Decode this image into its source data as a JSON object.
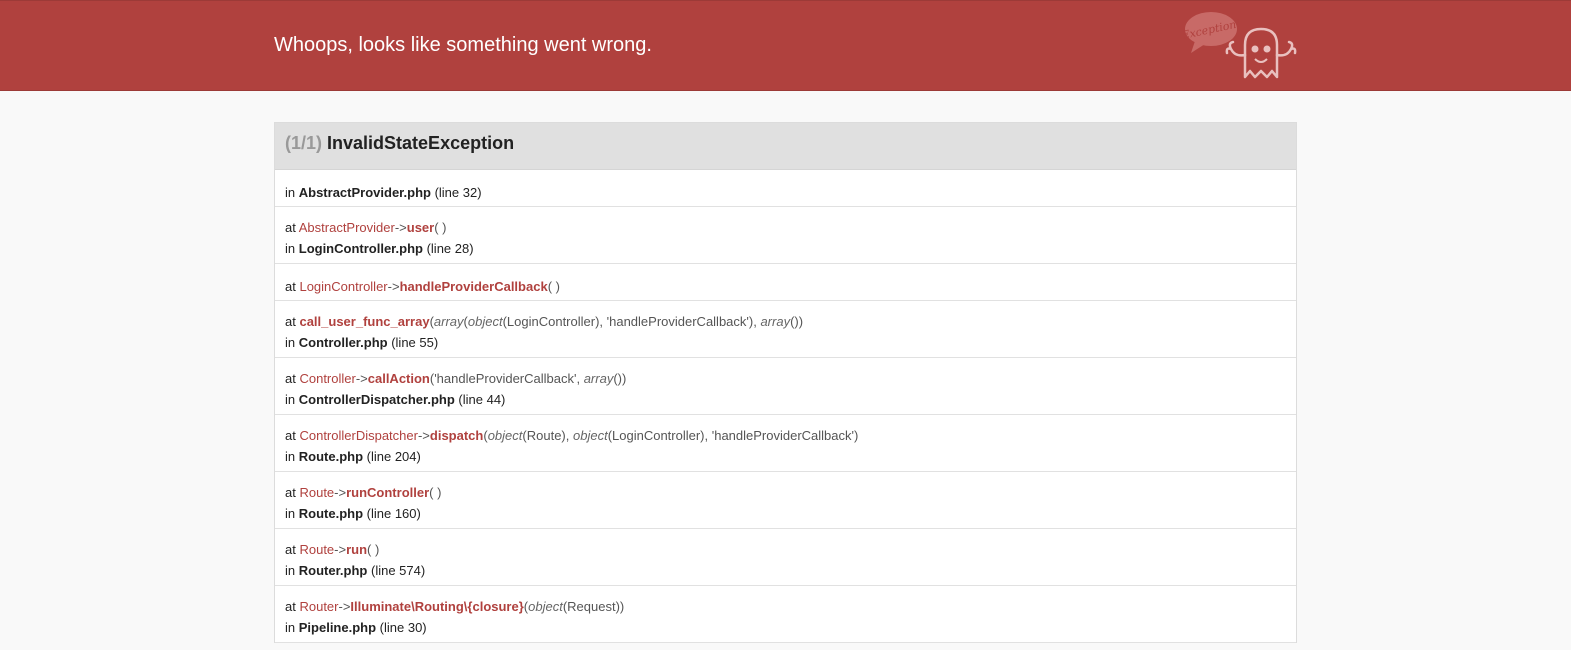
{
  "header": {
    "title": "Whoops, looks like something went wrong.",
    "logo_text": "Exception!",
    "logo_icon": "ghost-icon",
    "background": "#b0413e"
  },
  "exception": {
    "counter": "(1/1)",
    "name": "InvalidStateException",
    "origin": {
      "in": "in",
      "file": "AbstractProvider.php",
      "line": "(line 32)"
    }
  },
  "trace": [
    {
      "at": "at",
      "cls": "AbstractProvider",
      "arrow": "->",
      "fn": "user",
      "args": "( )",
      "in": "in",
      "file": "LoginController.php",
      "line": "(line 28)"
    },
    {
      "at": "at",
      "cls": "LoginController",
      "arrow": "->",
      "fn": "handleProviderCallback",
      "args": "( )"
    },
    {
      "at": "at",
      "cls": "",
      "arrow": "",
      "fn": "call_user_func_array",
      "args_html": "(<i>array</i>(<i>object</i>(LoginController), 'handleProviderCallback'), <i>array</i>())",
      "in": "in",
      "file": "Controller.php",
      "line": "(line 55)"
    },
    {
      "at": "at",
      "cls": "Controller",
      "arrow": "->",
      "fn": "callAction",
      "args_html": "('handleProviderCallback', <i>array</i>())",
      "in": "in",
      "file": "ControllerDispatcher.php",
      "line": "(line 44)"
    },
    {
      "at": "at",
      "cls": "ControllerDispatcher",
      "arrow": "->",
      "fn": "dispatch",
      "args_html": "(<i>object</i>(Route), <i>object</i>(LoginController), 'handleProviderCallback')",
      "in": "in",
      "file": "Route.php",
      "line": "(line 204)"
    },
    {
      "at": "at",
      "cls": "Route",
      "arrow": "->",
      "fn": "runController",
      "args": "( )",
      "in": "in",
      "file": "Route.php",
      "line": "(line 160)"
    },
    {
      "at": "at",
      "cls": "Route",
      "arrow": "->",
      "fn": "run",
      "args": "( )",
      "in": "in",
      "file": "Router.php",
      "line": "(line 574)"
    },
    {
      "at": "at",
      "cls": "Router",
      "arrow": "->",
      "fn": "Illuminate\\Routing\\{closure}",
      "args_html": "(<i>object</i>(Request))",
      "in": "in",
      "file": "Pipeline.php",
      "line": "(line 30)"
    }
  ]
}
